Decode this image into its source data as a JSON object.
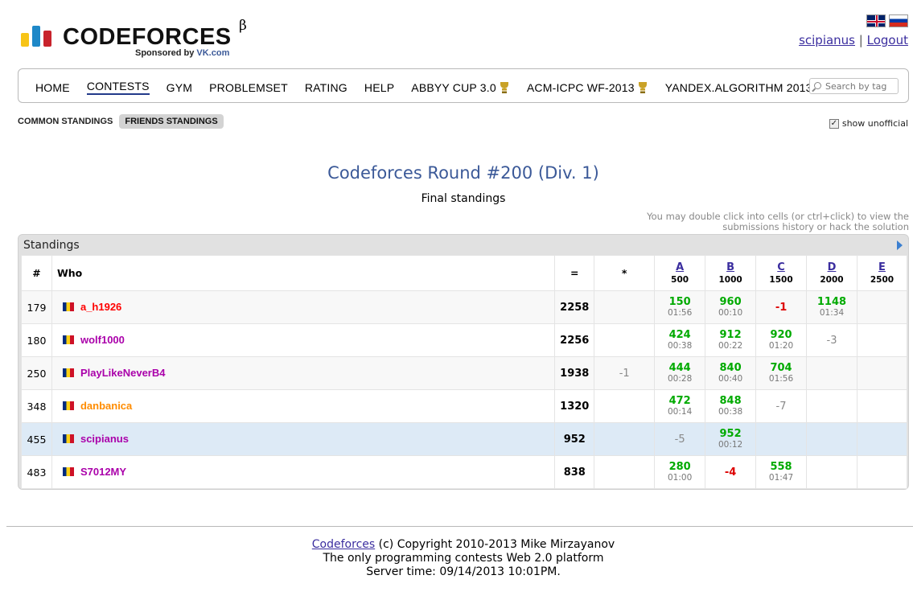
{
  "brand": {
    "logo_text": "CODEFORCES",
    "beta": "β",
    "sponsor_prefix": "Sponsored by",
    "sponsor_name": "VK.com",
    "colors": {
      "bar_yellow": "#f7c417",
      "bar_blue": "#1e88c8",
      "bar_red": "#c8232c",
      "accent_blue": "#3b5998"
    }
  },
  "languages": [
    "english-flag",
    "russian-flag"
  ],
  "user": {
    "handle": "scipianus",
    "separator": "|",
    "logout": "Logout"
  },
  "menu": {
    "items": [
      {
        "label": "HOME",
        "active": false,
        "cup": false
      },
      {
        "label": "CONTESTS",
        "active": true,
        "cup": false
      },
      {
        "label": "GYM",
        "active": false,
        "cup": false
      },
      {
        "label": "PROBLEMSET",
        "active": false,
        "cup": false
      },
      {
        "label": "RATING",
        "active": false,
        "cup": false
      },
      {
        "label": "HELP",
        "active": false,
        "cup": false
      },
      {
        "label": "ABBYY CUP 3.0",
        "active": false,
        "cup": true
      },
      {
        "label": "ACM-ICPC WF-2013",
        "active": false,
        "cup": true
      },
      {
        "label": "YANDEX.ALGORITHM 2013",
        "active": false,
        "cup": true
      }
    ],
    "search_placeholder": "Search by tag"
  },
  "subtabs": {
    "common": "COMMON STANDINGS",
    "friends": "FRIENDS STANDINGS"
  },
  "show_unofficial": {
    "label": "show unofficial",
    "checked": true
  },
  "contest": {
    "title": "Codeforces Round #200 (Div. 1)",
    "phase": "Final standings",
    "hint_line1": "You may double click into cells (or ctrl+click) to view the",
    "hint_line2": "submissions history or hack the solution"
  },
  "standings": {
    "caption": "Standings",
    "headers": {
      "rank": "#",
      "who": "Who",
      "points": "=",
      "hacks": "*"
    },
    "problems": [
      {
        "letter": "A",
        "points": "500"
      },
      {
        "letter": "B",
        "points": "1000"
      },
      {
        "letter": "C",
        "points": "1500"
      },
      {
        "letter": "D",
        "points": "2000"
      },
      {
        "letter": "E",
        "points": "2500"
      }
    ],
    "rows": [
      {
        "rank": "179",
        "handle": "a_h1926",
        "color": "#ff0000",
        "points": "2258",
        "hacks": "",
        "highlight": false,
        "cells": [
          {
            "v": "150",
            "t": "01:56",
            "s": "acc"
          },
          {
            "v": "960",
            "t": "00:10",
            "s": "acc"
          },
          {
            "v": "-1",
            "t": "",
            "s": "rej-red"
          },
          {
            "v": "1148",
            "t": "01:34",
            "s": "acc"
          },
          {
            "v": "",
            "t": "",
            "s": "empty"
          }
        ]
      },
      {
        "rank": "180",
        "handle": "wolf1000",
        "color": "#aa00aa",
        "points": "2256",
        "hacks": "",
        "highlight": false,
        "cells": [
          {
            "v": "424",
            "t": "00:38",
            "s": "acc"
          },
          {
            "v": "912",
            "t": "00:22",
            "s": "acc"
          },
          {
            "v": "920",
            "t": "01:20",
            "s": "acc"
          },
          {
            "v": "-3",
            "t": "",
            "s": "rej"
          },
          {
            "v": "",
            "t": "",
            "s": "empty"
          }
        ]
      },
      {
        "rank": "250",
        "handle": "PlayLikeNeverB4",
        "color": "#aa00aa",
        "points": "1938",
        "hacks": "-1",
        "highlight": false,
        "cells": [
          {
            "v": "444",
            "t": "00:28",
            "s": "acc"
          },
          {
            "v": "840",
            "t": "00:40",
            "s": "acc"
          },
          {
            "v": "704",
            "t": "01:56",
            "s": "acc"
          },
          {
            "v": "",
            "t": "",
            "s": "empty"
          },
          {
            "v": "",
            "t": "",
            "s": "empty"
          }
        ]
      },
      {
        "rank": "348",
        "handle": "danbanica",
        "color": "#ff8c00",
        "points": "1320",
        "hacks": "",
        "highlight": false,
        "cells": [
          {
            "v": "472",
            "t": "00:14",
            "s": "acc"
          },
          {
            "v": "848",
            "t": "00:38",
            "s": "acc"
          },
          {
            "v": "-7",
            "t": "",
            "s": "rej"
          },
          {
            "v": "",
            "t": "",
            "s": "empty"
          },
          {
            "v": "",
            "t": "",
            "s": "empty"
          }
        ]
      },
      {
        "rank": "455",
        "handle": "scipianus",
        "color": "#aa00aa",
        "points": "952",
        "hacks": "",
        "highlight": true,
        "cells": [
          {
            "v": "-5",
            "t": "",
            "s": "rej"
          },
          {
            "v": "952",
            "t": "00:12",
            "s": "acc"
          },
          {
            "v": "",
            "t": "",
            "s": "empty"
          },
          {
            "v": "",
            "t": "",
            "s": "empty"
          },
          {
            "v": "",
            "t": "",
            "s": "empty"
          }
        ]
      },
      {
        "rank": "483",
        "handle": "S7012MY",
        "color": "#aa00aa",
        "points": "838",
        "hacks": "",
        "highlight": false,
        "cells": [
          {
            "v": "280",
            "t": "01:00",
            "s": "acc"
          },
          {
            "v": "-4",
            "t": "",
            "s": "rej-red"
          },
          {
            "v": "558",
            "t": "01:47",
            "s": "acc"
          },
          {
            "v": "",
            "t": "",
            "s": "empty"
          },
          {
            "v": "",
            "t": "",
            "s": "empty"
          }
        ]
      }
    ]
  },
  "footer": {
    "link": "Codeforces",
    "copyright": " (c) Copyright 2010-2013 Mike Mirzayanov",
    "tagline": "The only programming contests Web 2.0 platform",
    "server_time": "Server time: 09/14/2013 10:01PM."
  }
}
